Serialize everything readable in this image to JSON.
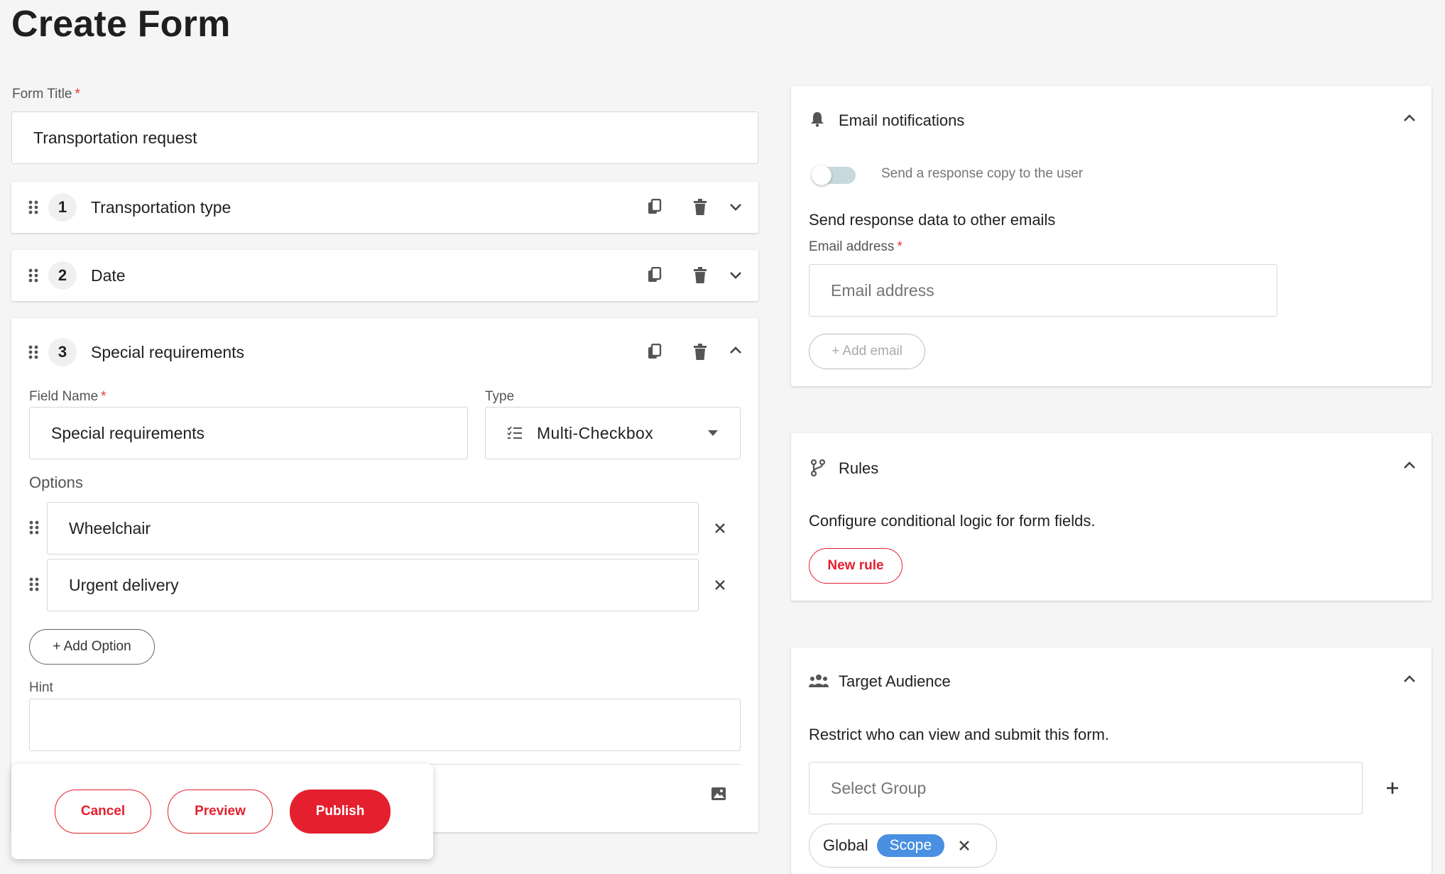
{
  "page": {
    "title": "Create Form"
  },
  "form_title": {
    "label": "Form Title",
    "required": "*",
    "value": "Transportation request"
  },
  "questions": [
    {
      "number": "1",
      "title": "Transportation type"
    },
    {
      "number": "2",
      "title": "Date"
    },
    {
      "number": "3",
      "title": "Special requirements"
    }
  ],
  "editor": {
    "field_name_label": "Field Name",
    "field_name_value": "Special requirements",
    "type_label": "Type",
    "type_value": "Multi-Checkbox",
    "options_label": "Options",
    "options": [
      "Wheelchair",
      "Urgent delivery"
    ],
    "add_option": "+ Add Option",
    "hint_label": "Hint",
    "hint_value": ""
  },
  "actions": {
    "cancel": "Cancel",
    "preview": "Preview",
    "publish": "Publish"
  },
  "email": {
    "title": "Email notifications",
    "toggle_label": "Send a response copy to the user",
    "other_title": "Send response data to other emails",
    "address_label": "Email address",
    "address_placeholder": "Email address",
    "add_email": "+ Add email"
  },
  "rules": {
    "title": "Rules",
    "description": "Configure conditional logic for form fields.",
    "new_rule": "New rule"
  },
  "audience": {
    "title": "Target Audience",
    "description": "Restrict who can view and submit this form.",
    "select_placeholder": "Select Group",
    "chip_name": "Global",
    "chip_badge": "Scope"
  },
  "colors": {
    "accent": "#e4202e",
    "scope": "#4a90e2",
    "toggle": "#c8d8de"
  }
}
